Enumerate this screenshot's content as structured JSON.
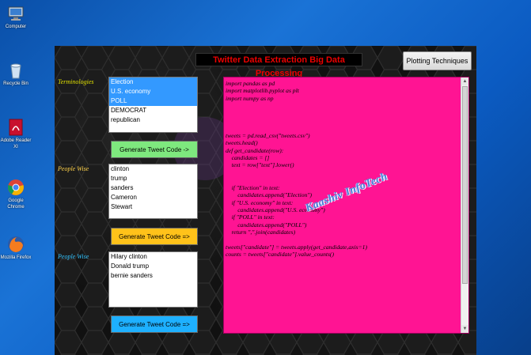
{
  "desktop": {
    "icons": [
      {
        "label": "Computer",
        "icon": "computer-icon"
      },
      {
        "label": "Recycle Bin",
        "icon": "recycle-bin-icon"
      },
      {
        "label": "Adobe Reader XI",
        "icon": "adobe-reader-icon"
      },
      {
        "label": "Google Chrome",
        "icon": "chrome-icon"
      },
      {
        "label": "Mozilla Firefox",
        "icon": "firefox-icon"
      }
    ]
  },
  "app": {
    "title": "Twitter Data Extraction  Big Data Processing",
    "plot_button": "Plotting Techniques",
    "sections": [
      {
        "label": "Terminologies",
        "label_color": "#e0e000",
        "items": [
          "Election",
          "U.S. economy",
          "POLL",
          "DEMOCRAT",
          "republican"
        ],
        "selected": [
          0,
          1,
          2
        ],
        "button": "Generate Tweet Code ->",
        "button_color": "#7ee87e"
      },
      {
        "label": "People Wise",
        "label_color": "#ffd24a",
        "items": [
          "clinton",
          "trump",
          "sanders",
          "Cameron",
          "Stewart"
        ],
        "selected": [],
        "button": "Generate Tweet Code =>",
        "button_color": "#ffc21a"
      },
      {
        "label": "People Wise",
        "label_color": "#33c4ff",
        "items": [
          "Hilary clinton",
          "Donald trump",
          "bernie sanders"
        ],
        "selected": [],
        "button": "Generate Tweet Code =>",
        "button_color": "#1eb0ff"
      }
    ],
    "code_lines": [
      "import pandas as pd",
      "import matplotlib.pyplot as plt",
      "import numpy as np",
      "",
      "",
      "",
      "",
      "tweets = pd.read_csv(\"tweets.csv\")",
      "tweets.head()",
      "def get_candidate(row):",
      "    candidates = []",
      "    text = row[\"text\"].lower()",
      "",
      "",
      "    if \"Election\" in text:",
      "        candidates.append(\"Election\")",
      "    if \"U.S. economy\" in text:",
      "        candidates.append(\"U.S. economy\")",
      "    if \"POLL\" in text:",
      "        candidates.append(\"POLL\")",
      "    return \",\".join(candidates)",
      "",
      "tweets[\"candidate\"] = tweets.apply(get_candidate,axis=1)",
      "counts = tweets[\"candidate\"].value_counts()"
    ],
    "watermark": "Kaashiv InfoTech"
  }
}
